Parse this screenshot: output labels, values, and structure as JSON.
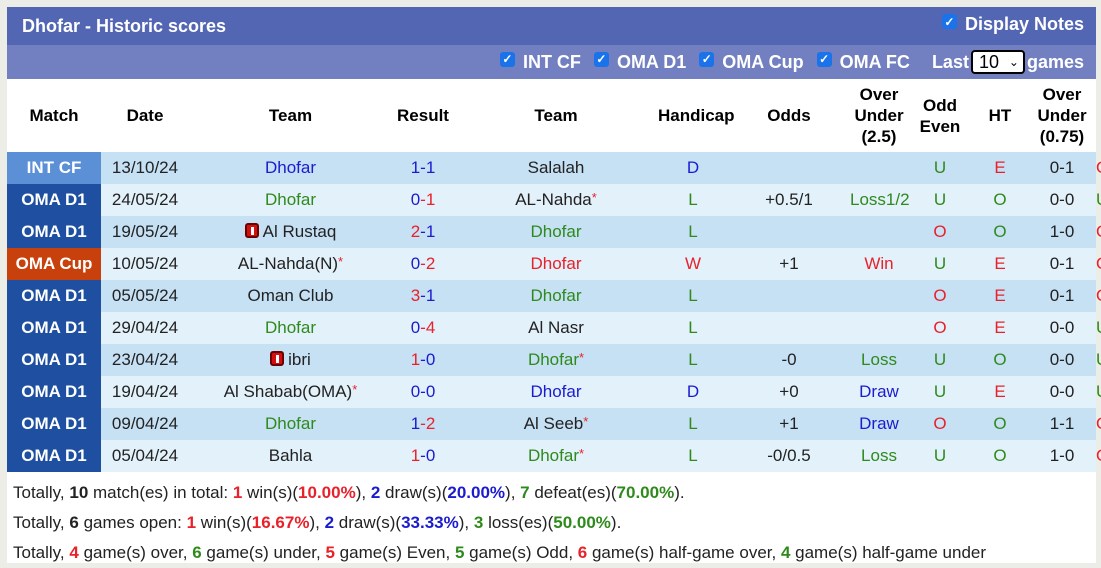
{
  "header": {
    "title": "Dhofar - Historic scores",
    "display_notes_label": "Display Notes",
    "display_notes_checked": true
  },
  "filters": {
    "items": [
      {
        "label": "INT CF",
        "checked": true
      },
      {
        "label": "OMA D1",
        "checked": true
      },
      {
        "label": "OMA Cup",
        "checked": true
      },
      {
        "label": "OMA FC",
        "checked": true
      }
    ],
    "last_label": "Last",
    "last_value": "10",
    "games_label": "games"
  },
  "table": {
    "columns": [
      "Match",
      "Date",
      "Team",
      "Result",
      "Team",
      "Handicap",
      "Odds",
      "Over Under (2.5)",
      "Odd Even",
      "HT",
      "Over Under (0.75)"
    ],
    "colors": {
      "blue": "#1b1bd0",
      "green": "#2f8a1c",
      "red": "#e8212a",
      "league_int_cf": "#5b8fd6",
      "league_oma_d1": "#1e4fa0",
      "league_oma_cup": "#c8410d"
    },
    "rows": [
      {
        "league": "INT CF",
        "league_color": "#5b8fd6",
        "date": "13/10/24",
        "home": "Dhofar",
        "home_color": "blue",
        "home_star": false,
        "home_redcard": false,
        "score_home": "1",
        "score_home_color": "blue",
        "score_away": "1",
        "score_away_color": "blue",
        "away": "Salalah",
        "away_color": "black",
        "away_star": false,
        "wdl": "D",
        "wdl_color": "blue",
        "handicap": "",
        "odds": "",
        "odds_color": "black",
        "ou": "U",
        "ou_color": "green",
        "oe": "E",
        "oe_color": "red",
        "ht": "0-1",
        "ou2": "O",
        "ou2_color": "red"
      },
      {
        "league": "OMA D1",
        "league_color": "#1e4fa0",
        "date": "24/05/24",
        "home": "Dhofar",
        "home_color": "green",
        "home_star": false,
        "home_redcard": false,
        "score_home": "0",
        "score_home_color": "blue",
        "score_away": "1",
        "score_away_color": "red",
        "away": "AL-Nahda",
        "away_color": "black",
        "away_star": true,
        "wdl": "L",
        "wdl_color": "green",
        "handicap": "+0.5/1",
        "odds": "Loss1/2",
        "odds_color": "green",
        "ou": "U",
        "ou_color": "green",
        "oe": "O",
        "oe_color": "green",
        "ht": "0-0",
        "ou2": "U",
        "ou2_color": "green"
      },
      {
        "league": "OMA D1",
        "league_color": "#1e4fa0",
        "date": "19/05/24",
        "home": "Al Rustaq",
        "home_color": "black",
        "home_star": false,
        "home_redcard": true,
        "score_home": "2",
        "score_home_color": "red",
        "score_away": "1",
        "score_away_color": "blue",
        "away": "Dhofar",
        "away_color": "green",
        "away_star": false,
        "wdl": "L",
        "wdl_color": "green",
        "handicap": "",
        "odds": "",
        "odds_color": "black",
        "ou": "O",
        "ou_color": "red",
        "oe": "O",
        "oe_color": "green",
        "ht": "1-0",
        "ou2": "O",
        "ou2_color": "red"
      },
      {
        "league": "OMA Cup",
        "league_color": "#c8410d",
        "date": "10/05/24",
        "home": "AL-Nahda(N)",
        "home_color": "black",
        "home_star": true,
        "home_redcard": false,
        "score_home": "0",
        "score_home_color": "blue",
        "score_away": "2",
        "score_away_color": "red",
        "away": "Dhofar",
        "away_color": "red",
        "away_star": false,
        "wdl": "W",
        "wdl_color": "red",
        "handicap": "+1",
        "odds": "Win",
        "odds_color": "red",
        "ou": "U",
        "ou_color": "green",
        "oe": "E",
        "oe_color": "red",
        "ht": "0-1",
        "ou2": "O",
        "ou2_color": "red"
      },
      {
        "league": "OMA D1",
        "league_color": "#1e4fa0",
        "date": "05/05/24",
        "home": "Oman Club",
        "home_color": "black",
        "home_star": false,
        "home_redcard": false,
        "score_home": "3",
        "score_home_color": "red",
        "score_away": "1",
        "score_away_color": "blue",
        "away": "Dhofar",
        "away_color": "green",
        "away_star": false,
        "wdl": "L",
        "wdl_color": "green",
        "handicap": "",
        "odds": "",
        "odds_color": "black",
        "ou": "O",
        "ou_color": "red",
        "oe": "E",
        "oe_color": "red",
        "ht": "0-1",
        "ou2": "O",
        "ou2_color": "red"
      },
      {
        "league": "OMA D1",
        "league_color": "#1e4fa0",
        "date": "29/04/24",
        "home": "Dhofar",
        "home_color": "green",
        "home_star": false,
        "home_redcard": false,
        "score_home": "0",
        "score_home_color": "blue",
        "score_away": "4",
        "score_away_color": "red",
        "away": "Al Nasr",
        "away_color": "black",
        "away_star": false,
        "wdl": "L",
        "wdl_color": "green",
        "handicap": "",
        "odds": "",
        "odds_color": "black",
        "ou": "O",
        "ou_color": "red",
        "oe": "E",
        "oe_color": "red",
        "ht": "0-0",
        "ou2": "U",
        "ou2_color": "green"
      },
      {
        "league": "OMA D1",
        "league_color": "#1e4fa0",
        "date": "23/04/24",
        "home": "ibri",
        "home_color": "black",
        "home_star": false,
        "home_redcard": true,
        "score_home": "1",
        "score_home_color": "red",
        "score_away": "0",
        "score_away_color": "blue",
        "away": "Dhofar",
        "away_color": "green",
        "away_star": true,
        "wdl": "L",
        "wdl_color": "green",
        "handicap": "-0",
        "odds": "Loss",
        "odds_color": "green",
        "ou": "U",
        "ou_color": "green",
        "oe": "O",
        "oe_color": "green",
        "ht": "0-0",
        "ou2": "U",
        "ou2_color": "green"
      },
      {
        "league": "OMA D1",
        "league_color": "#1e4fa0",
        "date": "19/04/24",
        "home": "Al Shabab(OMA)",
        "home_color": "black",
        "home_star": true,
        "home_redcard": false,
        "score_home": "0",
        "score_home_color": "blue",
        "score_away": "0",
        "score_away_color": "blue",
        "away": "Dhofar",
        "away_color": "blue",
        "away_star": false,
        "wdl": "D",
        "wdl_color": "blue",
        "handicap": "+0",
        "odds": "Draw",
        "odds_color": "blue",
        "ou": "U",
        "ou_color": "green",
        "oe": "E",
        "oe_color": "red",
        "ht": "0-0",
        "ou2": "U",
        "ou2_color": "green"
      },
      {
        "league": "OMA D1",
        "league_color": "#1e4fa0",
        "date": "09/04/24",
        "home": "Dhofar",
        "home_color": "green",
        "home_star": false,
        "home_redcard": false,
        "score_home": "1",
        "score_home_color": "blue",
        "score_away": "2",
        "score_away_color": "red",
        "away": "Al Seeb",
        "away_color": "black",
        "away_star": true,
        "wdl": "L",
        "wdl_color": "green",
        "handicap": "+1",
        "odds": "Draw",
        "odds_color": "blue",
        "ou": "O",
        "ou_color": "red",
        "oe": "O",
        "oe_color": "green",
        "ht": "1-1",
        "ou2": "O",
        "ou2_color": "red"
      },
      {
        "league": "OMA D1",
        "league_color": "#1e4fa0",
        "date": "05/04/24",
        "home": "Bahla",
        "home_color": "black",
        "home_star": false,
        "home_redcard": false,
        "score_home": "1",
        "score_home_color": "red",
        "score_away": "0",
        "score_away_color": "blue",
        "away": "Dhofar",
        "away_color": "green",
        "away_star": true,
        "wdl": "L",
        "wdl_color": "green",
        "handicap": "-0/0.5",
        "odds": "Loss",
        "odds_color": "green",
        "ou": "U",
        "ou_color": "green",
        "oe": "O",
        "oe_color": "green",
        "ht": "1-0",
        "ou2": "O",
        "ou2_color": "red"
      }
    ]
  },
  "summary": {
    "lines": [
      [
        {
          "t": "Totally, "
        },
        {
          "t": "10",
          "b": true,
          "c": "#222"
        },
        {
          "t": " match(es) in total: "
        },
        {
          "t": "1",
          "b": true,
          "c": "red"
        },
        {
          "t": " win(s)("
        },
        {
          "t": "10.00%",
          "b": true,
          "c": "red"
        },
        {
          "t": "), "
        },
        {
          "t": "2",
          "b": true,
          "c": "blue"
        },
        {
          "t": " draw(s)("
        },
        {
          "t": "20.00%",
          "b": true,
          "c": "blue"
        },
        {
          "t": "), "
        },
        {
          "t": "7",
          "b": true,
          "c": "green"
        },
        {
          "t": " defeat(es)("
        },
        {
          "t": "70.00%",
          "b": true,
          "c": "green"
        },
        {
          "t": ")."
        }
      ],
      [
        {
          "t": "Totally, "
        },
        {
          "t": "6",
          "b": true,
          "c": "#222"
        },
        {
          "t": " games open: "
        },
        {
          "t": "1",
          "b": true,
          "c": "red"
        },
        {
          "t": " win(s)("
        },
        {
          "t": "16.67%",
          "b": true,
          "c": "red"
        },
        {
          "t": "), "
        },
        {
          "t": "2",
          "b": true,
          "c": "blue"
        },
        {
          "t": " draw(s)("
        },
        {
          "t": "33.33%",
          "b": true,
          "c": "blue"
        },
        {
          "t": "), "
        },
        {
          "t": "3",
          "b": true,
          "c": "green"
        },
        {
          "t": " loss(es)("
        },
        {
          "t": "50.00%",
          "b": true,
          "c": "green"
        },
        {
          "t": ")."
        }
      ],
      [
        {
          "t": "Totally, "
        },
        {
          "t": "4",
          "b": true,
          "c": "red"
        },
        {
          "t": " game(s) over, "
        },
        {
          "t": "6",
          "b": true,
          "c": "green"
        },
        {
          "t": " game(s) under, "
        },
        {
          "t": "5",
          "b": true,
          "c": "red"
        },
        {
          "t": " game(s) Even, "
        },
        {
          "t": "5",
          "b": true,
          "c": "green"
        },
        {
          "t": " game(s) Odd, "
        },
        {
          "t": "6",
          "b": true,
          "c": "red"
        },
        {
          "t": " game(s) half-game over, "
        },
        {
          "t": "4",
          "b": true,
          "c": "green"
        },
        {
          "t": " game(s) half-game under"
        }
      ]
    ]
  }
}
